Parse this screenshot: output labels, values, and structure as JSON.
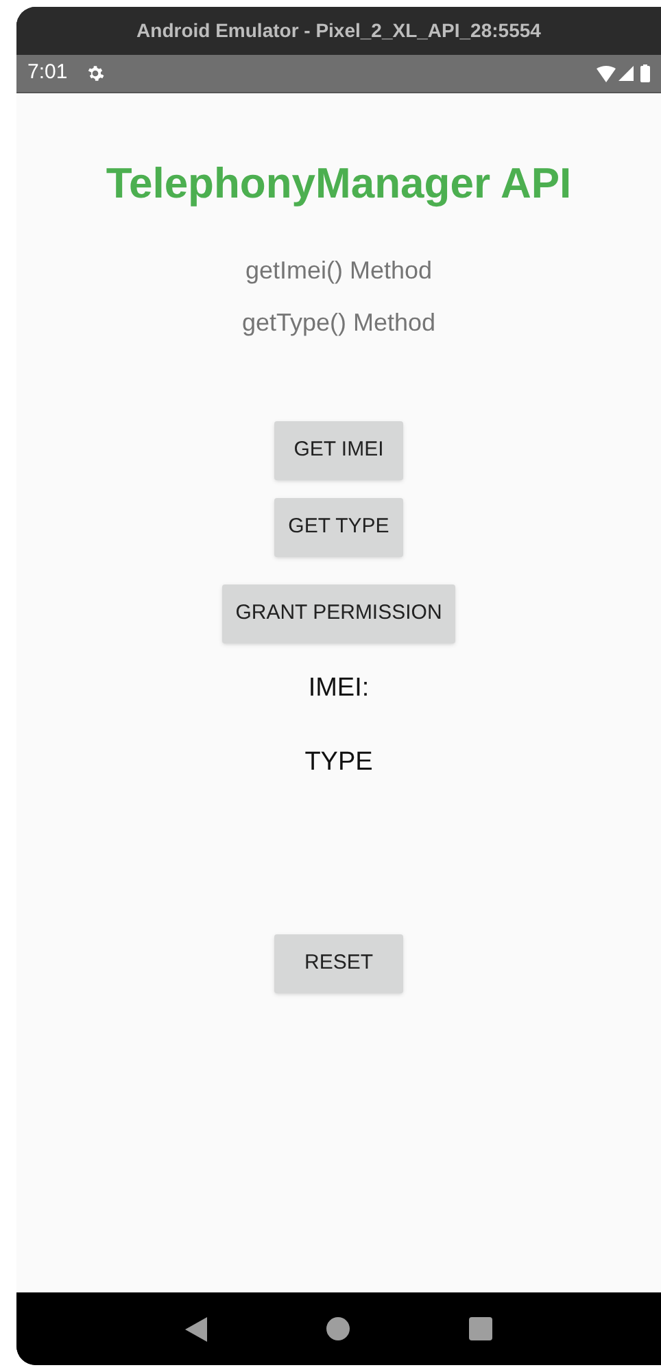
{
  "window": {
    "title": "Android Emulator - Pixel_2_XL_API_28:5554"
  },
  "status_bar": {
    "time": "7:01"
  },
  "app": {
    "title": "TelephonyManager API",
    "methods": [
      "getImei() Method",
      "getType() Method"
    ],
    "buttons": [
      {
        "label": "GET IMEI"
      },
      {
        "label": "GET TYPE"
      }
    ],
    "grant_button": "GRANT PERMISSION",
    "outputs": [
      "IMEI:",
      "TYPE"
    ],
    "reset_button": "RESET"
  }
}
